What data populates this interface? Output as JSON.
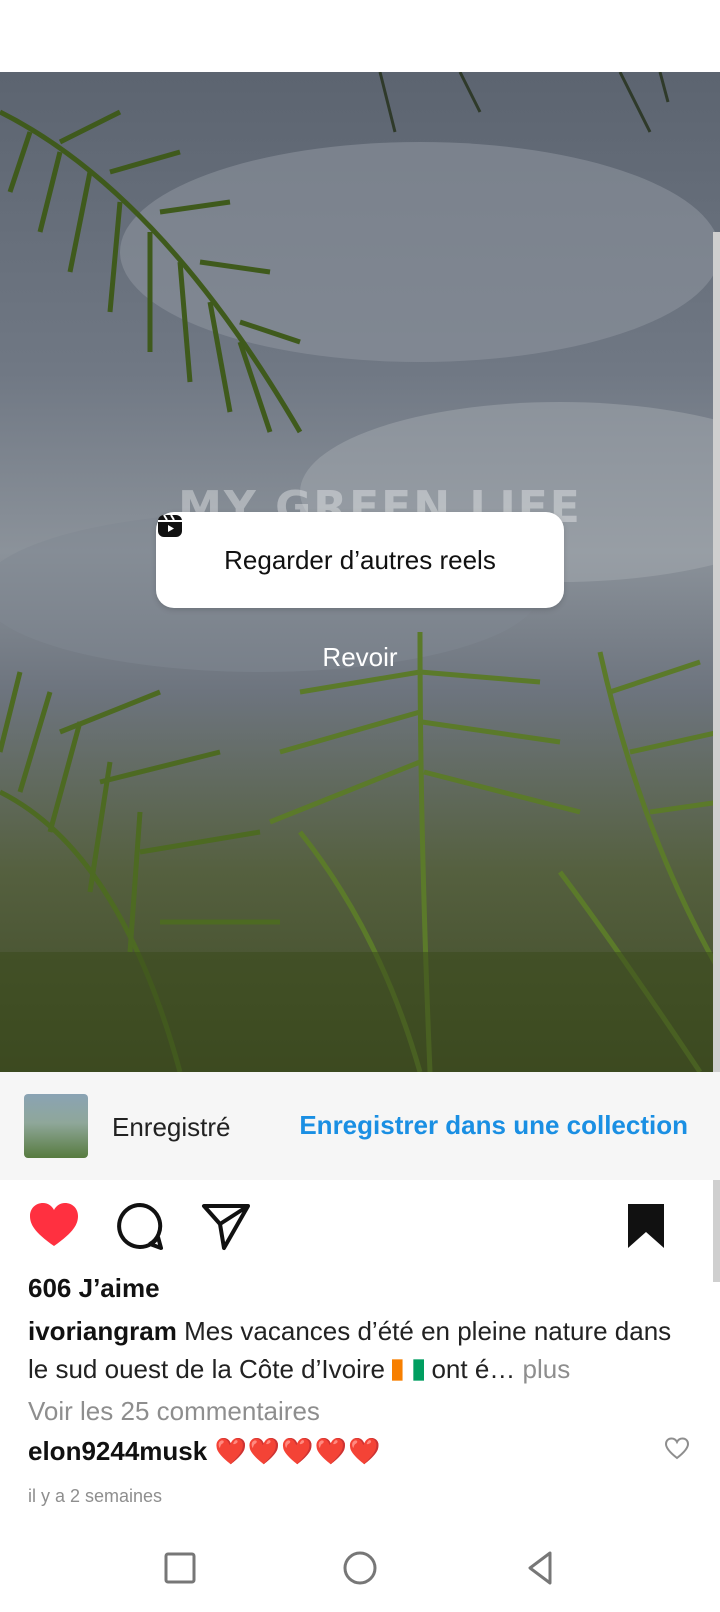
{
  "reel": {
    "overlay_title": "MY GREEN LIFE",
    "watch_more_label": "Regarder d’autres reels",
    "replay_label": "Revoir"
  },
  "saved": {
    "status": "Enregistré",
    "collection_link": "Enregistrer dans une collection"
  },
  "post": {
    "likes": "606 J’aime",
    "username": "ivoriangram",
    "caption": "Mes vacances d’été en pleine nature dans le sud ouest de la Côte d’Ivoire",
    "caption_suffix": " ont é…",
    "more_label": " plus",
    "view_comments": "Voir les 25 commentaires",
    "comment": {
      "user": "elon9244musk",
      "text": "❤️❤️❤️❤️❤️"
    },
    "timestamp": "il y a 2 semaines"
  },
  "colors": {
    "like_red": "#ff3040",
    "link_blue": "#1a8fe3",
    "muted": "#8e8e8e"
  },
  "icons": [
    "reels-icon",
    "heart-filled-icon",
    "comment-icon",
    "share-icon",
    "bookmark-filled-icon",
    "comment-heart-icon",
    "recent-apps-icon",
    "home-icon",
    "back-icon",
    "flag-icon"
  ]
}
